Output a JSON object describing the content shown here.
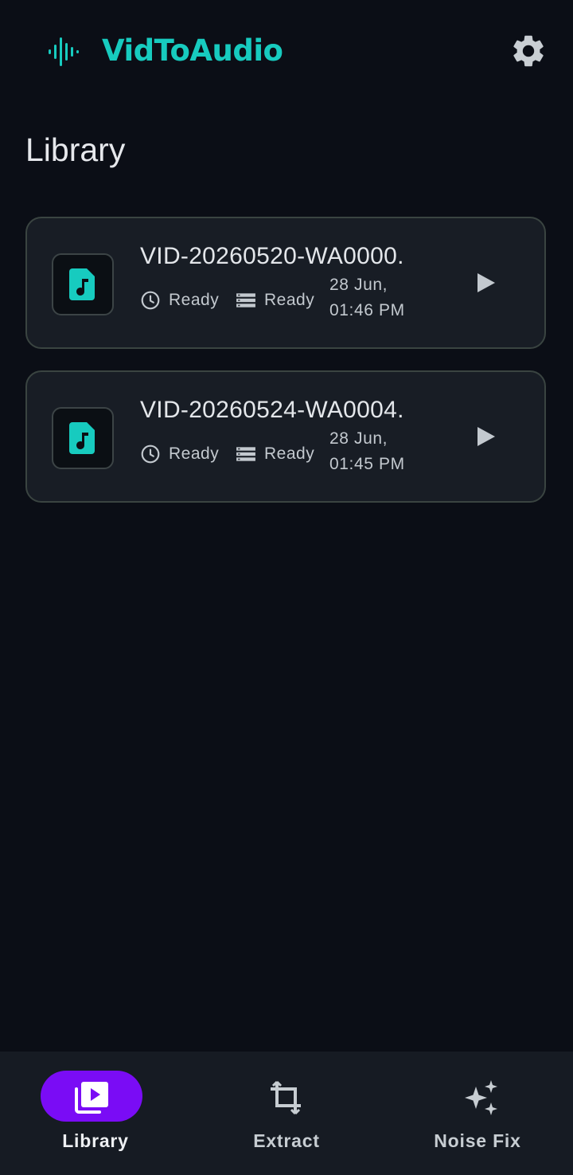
{
  "app": {
    "title": "VidToAudio",
    "accent_color": "#17cbbf",
    "logo_icon": "waveform-icon",
    "settings_icon": "gear-icon"
  },
  "page": {
    "title": "Library"
  },
  "items": [
    {
      "title": "VID-20260520-WA0000.",
      "status": "Ready",
      "format": "Ready",
      "date_line1": "28 Jun,",
      "date_line2": "01:46 PM",
      "thumb_icon": "audio-file-icon",
      "action_icon": "play-icon"
    },
    {
      "title": "VID-20260524-WA0004.",
      "status": "Ready",
      "format": "Ready",
      "date_line1": "28 Jun,",
      "date_line2": "01:45 PM",
      "thumb_icon": "audio-file-icon",
      "action_icon": "play-icon"
    }
  ],
  "bottom_nav": {
    "active_color": "#7a0cf5",
    "items": [
      {
        "label": "Library",
        "icon": "video-library-icon",
        "active": true
      },
      {
        "label": "Extract",
        "icon": "crop-icon",
        "active": false
      },
      {
        "label": "Noise Fix",
        "icon": "sparkle-icon",
        "active": false
      }
    ]
  }
}
